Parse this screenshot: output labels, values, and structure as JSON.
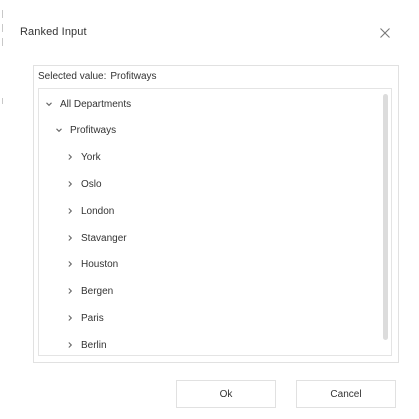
{
  "dialog": {
    "title": "Ranked Input",
    "selected_label": "Selected value:",
    "selected_value": "Profitways"
  },
  "tree": {
    "root": {
      "label": "All Departments",
      "expanded": true
    },
    "group": {
      "label": "Profitways",
      "expanded": true
    },
    "children": [
      {
        "label": "York"
      },
      {
        "label": "Oslo"
      },
      {
        "label": "London"
      },
      {
        "label": "Stavanger"
      },
      {
        "label": "Houston"
      },
      {
        "label": "Bergen"
      },
      {
        "label": "Paris"
      },
      {
        "label": "Berlin"
      }
    ]
  },
  "buttons": {
    "ok_label": "Ok",
    "cancel_label": "Cancel"
  },
  "icons": {
    "close": "close-icon",
    "expanded": "chevron-down-icon",
    "collapsed": "chevron-right-icon"
  },
  "colors": {
    "text": "#333333",
    "border": "#e1e1e1",
    "scroll_thumb": "#dcdcdc"
  }
}
